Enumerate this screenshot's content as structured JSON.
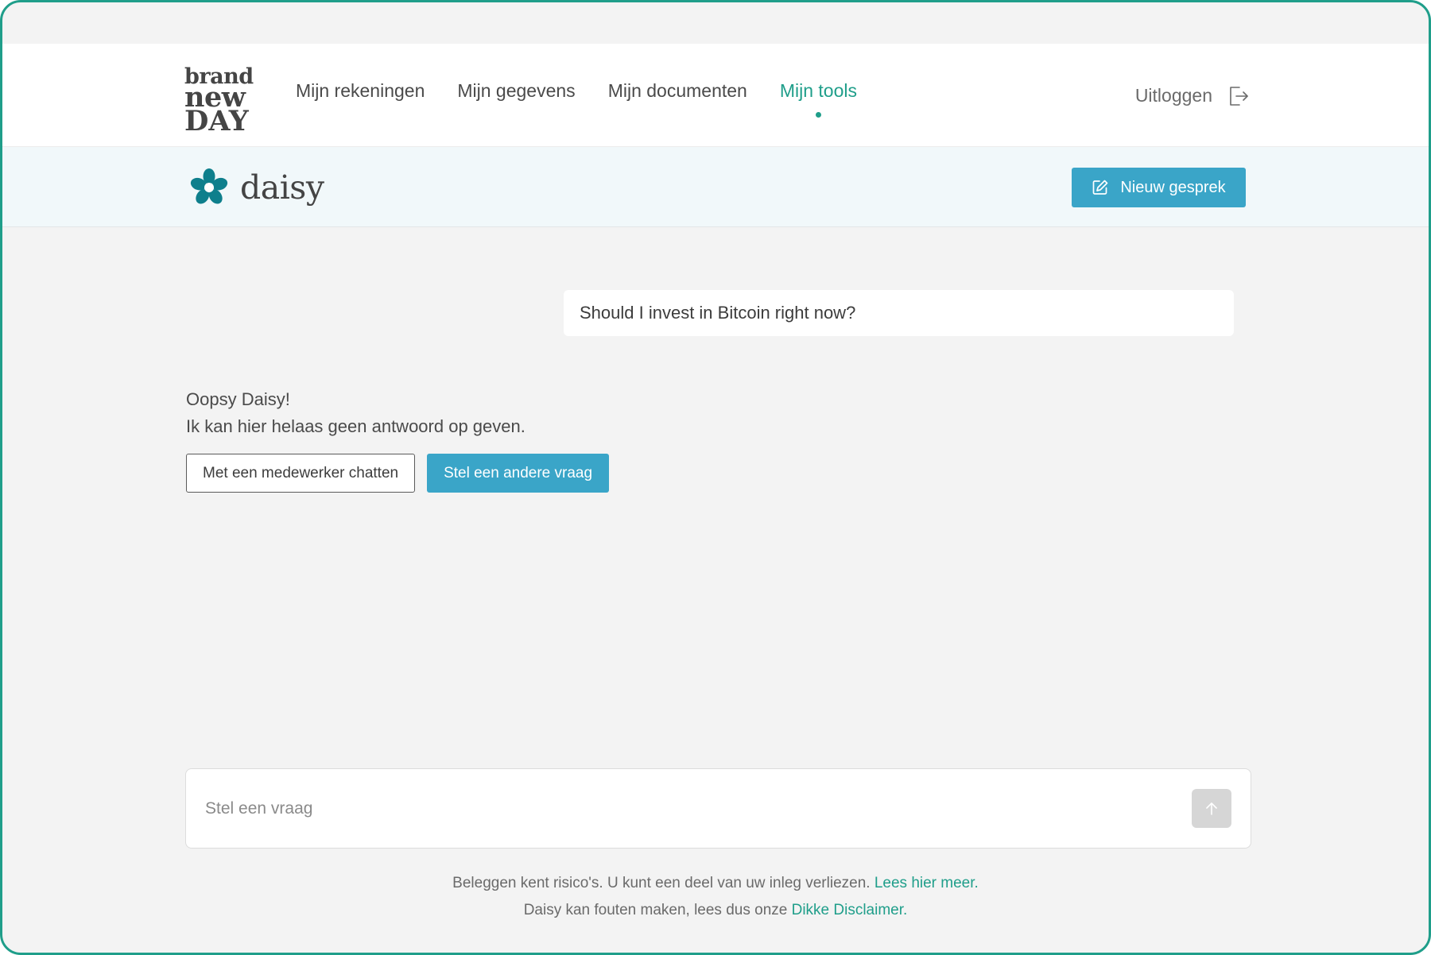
{
  "header": {
    "logo": {
      "line1": "brand",
      "line2": "new",
      "line3": "DAY"
    },
    "nav": [
      {
        "label": "Mijn rekeningen",
        "active": false
      },
      {
        "label": "Mijn gegevens",
        "active": false
      },
      {
        "label": "Mijn documenten",
        "active": false
      },
      {
        "label": "Mijn tools",
        "active": true
      }
    ],
    "logout_label": "Uitloggen"
  },
  "daisy_bar": {
    "name": "daisy",
    "new_chat_label": "Nieuw gesprek"
  },
  "chat": {
    "user_message": "Should I invest in Bitcoin right now?",
    "bot_line1": "Oopsy Daisy!",
    "bot_line2": "Ik kan hier helaas geen antwoord op geven.",
    "action_chat_employee": "Met een medewerker chatten",
    "action_other_question": "Stel een andere vraag"
  },
  "composer": {
    "placeholder": "Stel een vraag"
  },
  "footer": {
    "risk_text": "Beleggen kent risico's. U kunt een deel van uw inleg verliezen.",
    "risk_link": "Lees hier meer.",
    "daisy_text": "Daisy kan fouten maken, lees dus onze",
    "daisy_link": "Dikke Disclaimer."
  },
  "colors": {
    "accent_green": "#1f9e8a",
    "button_blue": "#3aa5c8",
    "daisy_teal": "#0e7f8c"
  }
}
